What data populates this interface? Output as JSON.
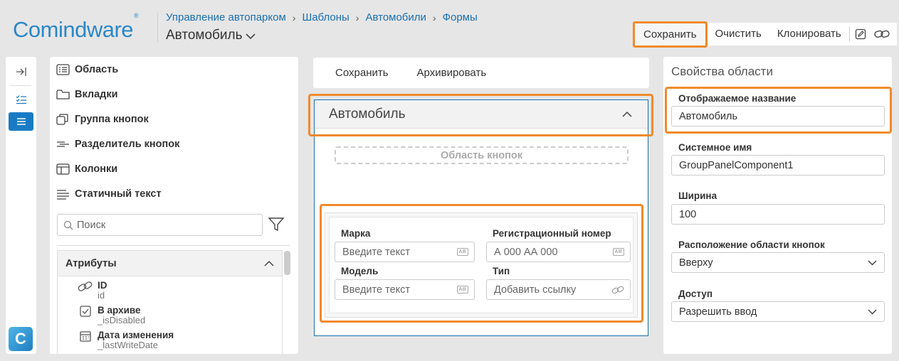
{
  "logo": {
    "text": "Comindware",
    "mark": "®"
  },
  "breadcrumb": [
    "Управление автопарком",
    "Шаблоны",
    "Автомобили",
    "Формы"
  ],
  "page_title": "Автомобиль",
  "toolbar": {
    "save": "Сохранить",
    "clear": "Очистить",
    "clone": "Клонировать",
    "icons": [
      "edit-icon",
      "link-icon"
    ]
  },
  "rail": {
    "icons": [
      "expand-icon",
      "checklist-icon",
      "list-icon"
    ],
    "badge": "C"
  },
  "palette": {
    "items": [
      "Область",
      "Вкладки",
      "Группа кнопок",
      "Разделитель кнопок",
      "Колонки",
      "Статичный текст"
    ],
    "search_placeholder": "Поиск",
    "attributes_title": "Атрибуты",
    "attributes": [
      {
        "name": "ID",
        "system": "id"
      },
      {
        "name": "В архиве",
        "system": "_isDisabled"
      },
      {
        "name": "Дата изменения",
        "system": "_lastWriteDate"
      }
    ]
  },
  "canvas": {
    "top_buttons": [
      "Сохранить",
      "Архивировать"
    ],
    "card_title": "Автомобиль",
    "buttons_area": "Область кнопок",
    "fields": [
      {
        "label": "Марка",
        "placeholder": "Введите текст"
      },
      {
        "label": "Регистрационный номер",
        "placeholder": "А 000 АА 000"
      },
      {
        "label": "Модель",
        "placeholder": "Введите текст"
      },
      {
        "label": "Тип",
        "placeholder": "Добавить ссылку"
      }
    ],
    "text_badge": "AB"
  },
  "properties": {
    "title": "Свойства области",
    "display_name_label": "Отображаемое название",
    "display_name_value": "Автомобиль",
    "system_name_label": "Системное имя",
    "system_name_value": "GroupPanelComponent1",
    "width_label": "Ширина",
    "width_value": "100",
    "buttons_pos_label": "Расположение области кнопок",
    "buttons_pos_value": "Вверху",
    "access_label": "Доступ",
    "access_value": "Разрешить ввод"
  },
  "colors": {
    "accent": "#1a7bc4",
    "highlight": "#f08a2c",
    "link": "#1a6fb0",
    "background": "#e6e6e6"
  }
}
